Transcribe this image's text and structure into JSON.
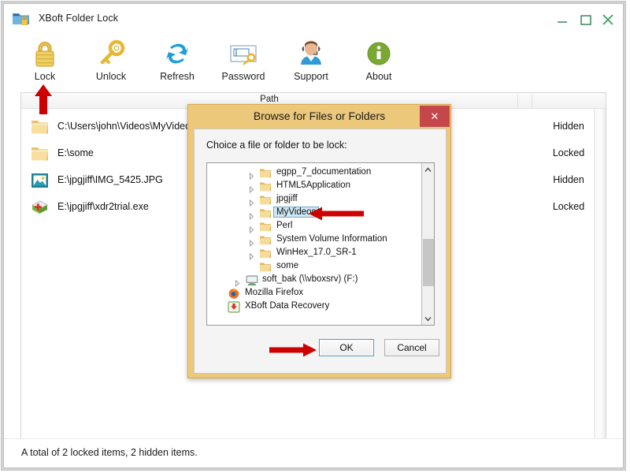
{
  "window": {
    "title": "XBoft Folder Lock",
    "app_icon": "folder-lock-icon",
    "controls": {
      "minimize": "minimize-icon",
      "maximize": "maximize-icon",
      "close": "close-icon"
    }
  },
  "toolbar": {
    "items": [
      {
        "label": "Lock",
        "icon": "padlock-icon"
      },
      {
        "label": "Unlock",
        "icon": "key-icon"
      },
      {
        "label": "Refresh",
        "icon": "refresh-arrows-icon"
      },
      {
        "label": "Password",
        "icon": "password-field-key-icon"
      },
      {
        "label": "Support",
        "icon": "headset-agent-icon"
      },
      {
        "label": "About",
        "icon": "info-circle-icon"
      }
    ]
  },
  "list": {
    "columns": [
      "Path",
      "",
      ""
    ],
    "header_label": "Path",
    "rows": [
      {
        "icon": "folder-icon",
        "path": "C:\\Users\\john\\Videos\\MyVideo",
        "status": "Hidden"
      },
      {
        "icon": "folder-icon",
        "path": "E:\\some",
        "status": "Locked"
      },
      {
        "icon": "image-file-icon",
        "path": "E:\\jpgjiff\\IMG_5425.JPG",
        "status": "Hidden"
      },
      {
        "icon": "setup-exe-icon",
        "path": "E:\\jpgjiff\\xdr2trial.exe",
        "status": "Locked"
      }
    ]
  },
  "status_bar": {
    "text": "A total of 2 locked items, 2 hidden items."
  },
  "dialog": {
    "title": "Browse for Files or Folders",
    "close_label": "✕",
    "prompt": "Choice a file or folder to be lock:",
    "tree": [
      {
        "label": "egpp_7_documentation",
        "icon": "folder-icon",
        "indent": 2,
        "expandable": true,
        "selected": false
      },
      {
        "label": "HTML5Application",
        "icon": "folder-icon",
        "indent": 2,
        "expandable": true,
        "selected": false
      },
      {
        "label": "jpgjiff",
        "icon": "folder-icon",
        "indent": 2,
        "expandable": true,
        "selected": false
      },
      {
        "label": "MyVideos",
        "icon": "folder-icon",
        "indent": 2,
        "expandable": true,
        "selected": true
      },
      {
        "label": "Perl",
        "icon": "folder-icon",
        "indent": 2,
        "expandable": true,
        "selected": false
      },
      {
        "label": "System Volume Information",
        "icon": "folder-icon",
        "indent": 2,
        "expandable": true,
        "selected": false
      },
      {
        "label": "WinHex_17.0_SR-1",
        "icon": "folder-icon",
        "indent": 2,
        "expandable": true,
        "selected": false
      },
      {
        "label": "some",
        "icon": "folder-icon",
        "indent": 2,
        "expandable": false,
        "selected": false
      },
      {
        "label": "soft_bak (\\\\vboxsrv) (F:)",
        "icon": "network-drive-icon",
        "indent": 1,
        "expandable": true,
        "selected": false
      },
      {
        "label": "Mozilla Firefox",
        "icon": "firefox-icon",
        "indent": 0,
        "expandable": false,
        "selected": false
      },
      {
        "label": "XBoft Data Recovery",
        "icon": "xboft-recovery-icon",
        "indent": 0,
        "expandable": false,
        "selected": false
      }
    ],
    "buttons": {
      "ok": "OK",
      "cancel": "Cancel"
    }
  },
  "annotations": {
    "arrow_to_lock_button": "red-arrow-up-icon",
    "arrow_to_myvideos": "red-arrow-left-icon",
    "arrow_to_ok_button": "red-arrow-right-icon"
  },
  "colors": {
    "dialog_border": "#ecc87a",
    "dialog_close": "#c5474b",
    "selection": "#cde8f6",
    "annotation": "#cc0000",
    "accent_blue": "#4d9ad6"
  }
}
